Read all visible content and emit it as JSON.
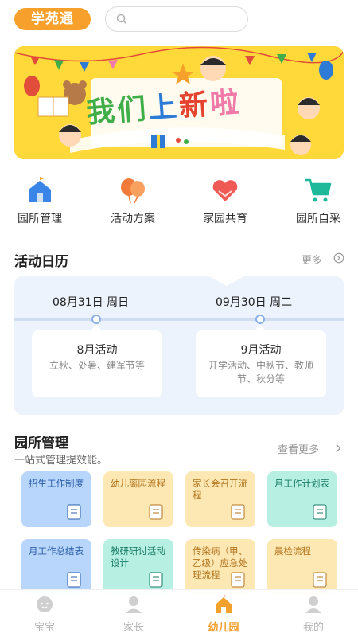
{
  "app": {
    "logo_text": "学苑通"
  },
  "search": {
    "placeholder": ""
  },
  "banner": {
    "headline_parts": [
      "我",
      "们",
      "上",
      "新",
      "啦"
    ]
  },
  "quick_entries": [
    {
      "label": "园所管理",
      "icon": "school-building-icon",
      "color": "#3a86e8"
    },
    {
      "label": "活动方案",
      "icon": "balloons-icon",
      "color": "#f27b3c"
    },
    {
      "label": "家园共育",
      "icon": "heart-hands-icon",
      "color": "#f05a55"
    },
    {
      "label": "园所自采",
      "icon": "shopping-cart-icon",
      "color": "#1db99a"
    }
  ],
  "calendar_section": {
    "title": "活动日历",
    "more_label": "更多",
    "dates": [
      {
        "date": "08月31日 周日"
      },
      {
        "date": "09月30日 周二"
      }
    ],
    "cards": [
      {
        "title": "8月活动",
        "desc": "立秋、处暑、建军节等"
      },
      {
        "title": "9月活动",
        "desc": "开学活动、中秋节、教师节、秋分等"
      }
    ]
  },
  "management_section": {
    "title": "园所管理",
    "subtitle": "一站式管理提效能。",
    "more_label": "查看更多",
    "tiles": [
      {
        "label": "招生工作制度",
        "style": "blue"
      },
      {
        "label": "幼儿离园流程",
        "style": "yellow"
      },
      {
        "label": "家长会召开流程",
        "style": "yellow"
      },
      {
        "label": "月工作计划表",
        "style": "teal"
      },
      {
        "label": "月工作总结表",
        "style": "blue"
      },
      {
        "label": "教研研讨活动设计",
        "style": "teal"
      },
      {
        "label": "传染病（甲、乙级）应急处理流程",
        "style": "yellow"
      },
      {
        "label": "晨检流程",
        "style": "yellow"
      }
    ]
  },
  "tabbar": {
    "items": [
      {
        "label": "宝宝",
        "icon": "baby-face-icon"
      },
      {
        "label": "家长",
        "icon": "parent-avatar-icon"
      },
      {
        "label": "幼儿园",
        "icon": "kindergarten-house-icon"
      },
      {
        "label": "我的",
        "icon": "profile-icon"
      }
    ],
    "active_index": 2,
    "active_color": "#f3a12d",
    "inactive_color": "#c8c8c8"
  }
}
